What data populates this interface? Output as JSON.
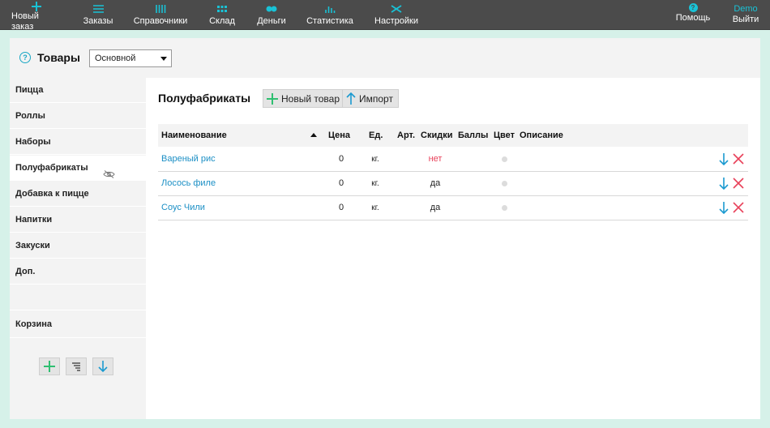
{
  "nav": {
    "items": [
      {
        "label": "Новый заказ",
        "icon": "plus-icon"
      },
      {
        "label": "Заказы",
        "icon": "menu-lines-icon"
      },
      {
        "label": "Справочники",
        "icon": "bars-icon"
      },
      {
        "label": "Склад",
        "icon": "grid-icon"
      },
      {
        "label": "Деньги",
        "icon": "coins-icon"
      },
      {
        "label": "Статистика",
        "icon": "chart-icon"
      },
      {
        "label": "Настройки",
        "icon": "tools-icon"
      }
    ],
    "help": {
      "label": "Помощь",
      "badge": "?"
    },
    "user": {
      "name": "Demo",
      "logout": "Выйти"
    }
  },
  "header": {
    "help_glyph": "?",
    "title": "Товары",
    "select_value": "Основной"
  },
  "sidebar": {
    "items": [
      {
        "label": "Пицца"
      },
      {
        "label": "Роллы"
      },
      {
        "label": "Наборы"
      },
      {
        "label": "Полуфабрикаты"
      },
      {
        "label": "Добавка к пицце"
      },
      {
        "label": "Напитки"
      },
      {
        "label": "Закуски"
      },
      {
        "label": "Доп."
      },
      {
        "label": ""
      },
      {
        "label": "Корзина"
      }
    ]
  },
  "main": {
    "section_title": "Полуфабрикаты",
    "new_button": "Новый товар",
    "import_button": "Импорт",
    "columns": {
      "name": "Наименование",
      "price": "Цена",
      "unit": "Ед.",
      "art": "Арт.",
      "discount": "Скидки",
      "points": "Баллы",
      "color": "Цвет",
      "description": "Описание"
    },
    "rows": [
      {
        "name": "Вареный рис",
        "price": "0",
        "unit": "кг.",
        "discount": "нет"
      },
      {
        "name": "Лосось филе",
        "price": "0",
        "unit": "кг.",
        "discount": "да"
      },
      {
        "name": "Соус Чили",
        "price": "0",
        "unit": "кг.",
        "discount": "да"
      }
    ]
  },
  "colors": {
    "accent": "#19c2d6",
    "link": "#1b8fc5",
    "add_green": "#2fbf71",
    "delete_red": "#e8415a",
    "topbar": "#4b4b4b",
    "background": "#d6f1e9"
  }
}
